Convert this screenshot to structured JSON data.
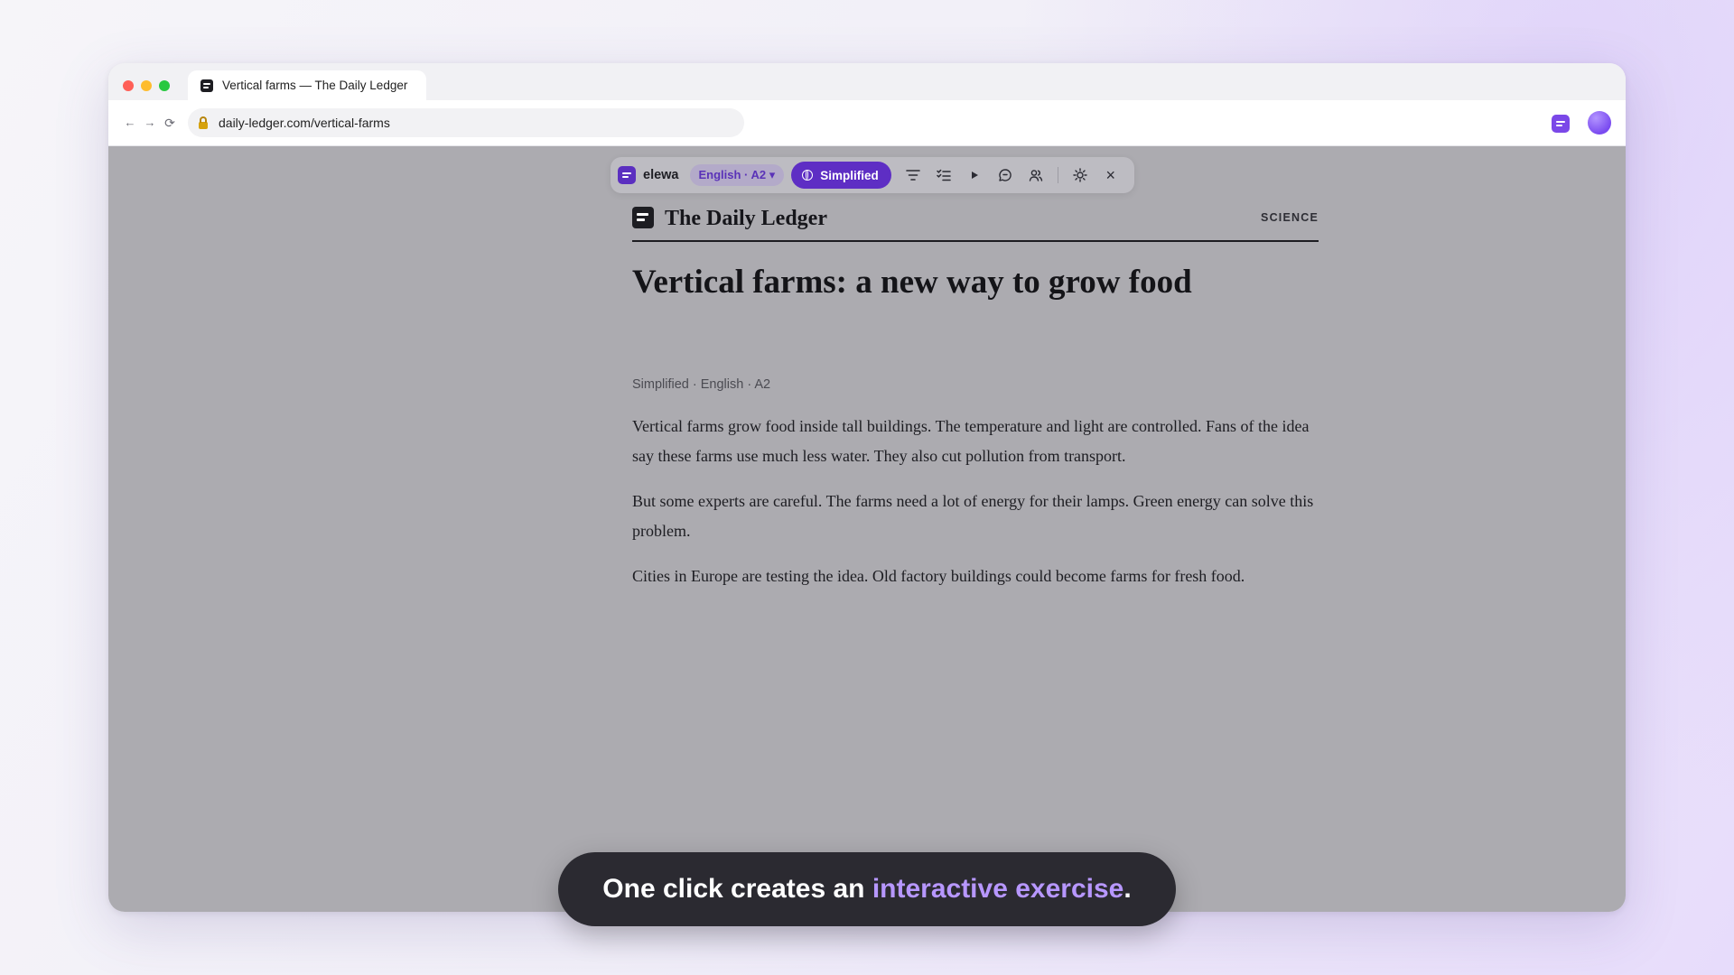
{
  "browser": {
    "tab_title": "Vertical farms — The Daily Ledger",
    "url": "daily-ledger.com/vertical-farms",
    "nav": {
      "back": "←",
      "forward": "→",
      "reload": "⟳"
    }
  },
  "extension_bar": {
    "name": "elewa",
    "language_level": "English · A2",
    "mode_label": "Simplified",
    "close": "×"
  },
  "article": {
    "publication": "The Daily Ledger",
    "section": "SCIENCE",
    "headline": "Vertical farms: a new way to grow food",
    "meta": "Simplified · English · A2",
    "paragraphs": [
      "Vertical farms grow food inside tall buildings. The temperature and light are controlled. Fans of the idea say these farms use much less water. They also cut pollution from transport.",
      "But some experts are careful. The farms need a lot of energy for their lamps. Green energy can solve this problem.",
      "Cities in Europe are testing the idea. Old factory buildings could become farms for fresh food."
    ]
  },
  "caption": {
    "before": "One click creates an ",
    "highlight": "interactive exercise",
    "after": "."
  },
  "colors": {
    "accent": "#5e2ec4",
    "highlight": "#b797ff",
    "overlay": "#acabb0"
  }
}
